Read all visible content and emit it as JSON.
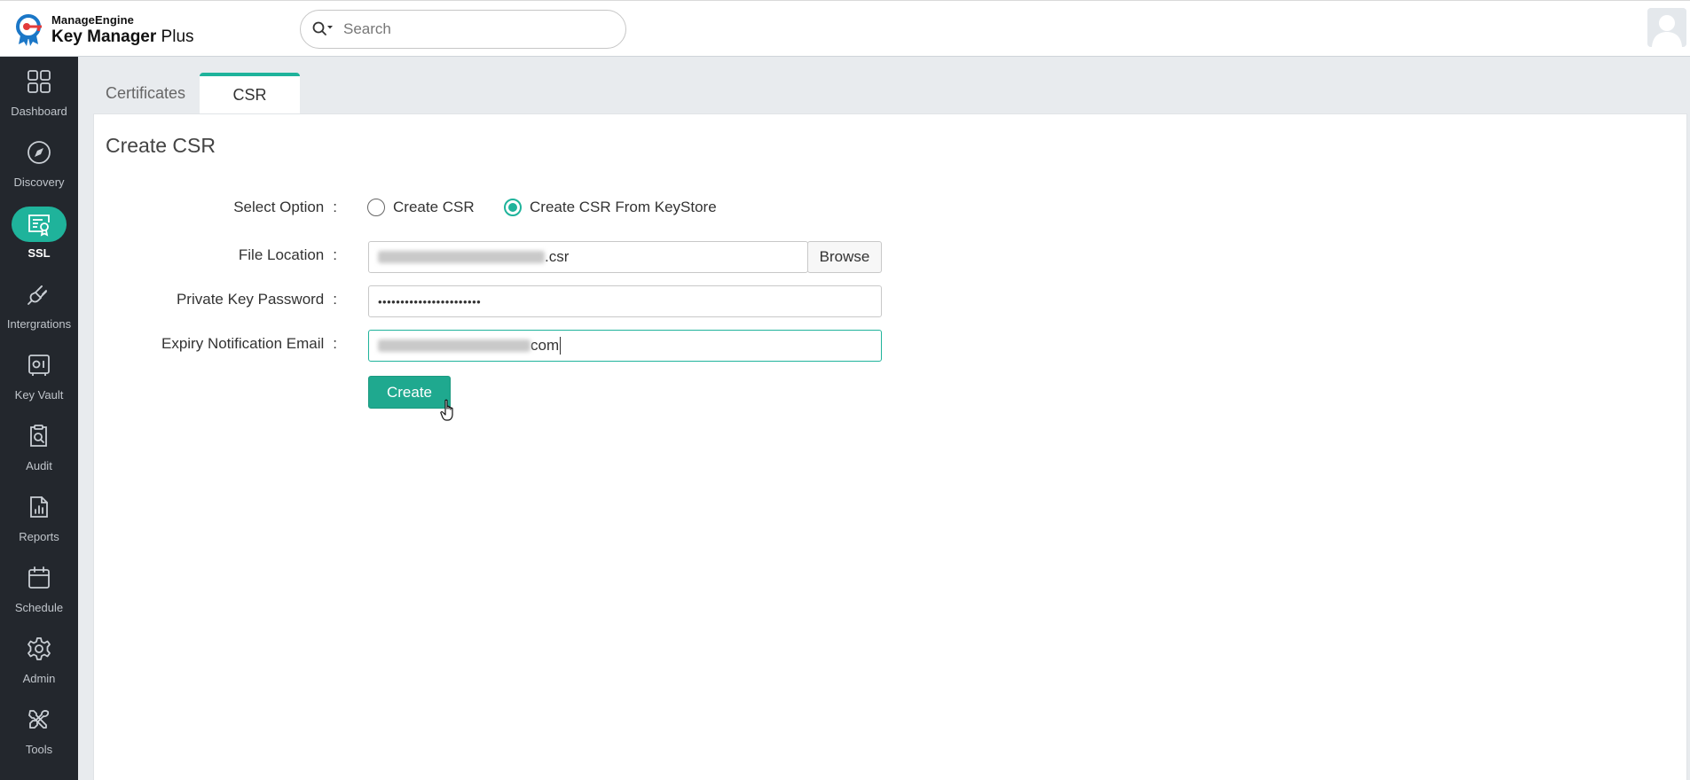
{
  "header": {
    "brand": "ManageEngine",
    "product_bold": "Key Manager",
    "product_rest": " Plus",
    "search_placeholder": "Search"
  },
  "sidebar": {
    "items": [
      {
        "label": "Dashboard",
        "icon": "dashboard-icon"
      },
      {
        "label": "Discovery",
        "icon": "compass-icon"
      },
      {
        "label": "SSL",
        "icon": "certificate-icon",
        "active": true
      },
      {
        "label": "Intergrations",
        "icon": "plug-icon"
      },
      {
        "label": "Key Vault",
        "icon": "vault-icon"
      },
      {
        "label": "Audit",
        "icon": "audit-icon"
      },
      {
        "label": "Reports",
        "icon": "report-icon"
      },
      {
        "label": "Schedule",
        "icon": "calendar-icon"
      },
      {
        "label": "Admin",
        "icon": "gear-icon"
      },
      {
        "label": "Tools",
        "icon": "tools-icon"
      }
    ]
  },
  "tabs": [
    {
      "label": "Certificates",
      "active": false
    },
    {
      "label": "CSR",
      "active": true
    }
  ],
  "form": {
    "title": "Create CSR",
    "select_option_label": "Select Option",
    "option_create_csr": "Create CSR",
    "option_from_keystore": "Create CSR From KeyStore",
    "selected_option": "Create CSR From KeyStore",
    "file_location_label": "File Location",
    "file_location_value_suffix": ".csr",
    "browse_label": "Browse",
    "private_key_password_label": "Private Key Password",
    "private_key_password_value": "•••••••••••••••••••••••",
    "expiry_email_label": "Expiry Notification Email",
    "expiry_email_value_suffix": "com",
    "create_label": "Create",
    "colon": ":"
  },
  "colors": {
    "accent": "#1fb39b",
    "sidebar_bg": "#23272d",
    "button": "#1fa98f"
  }
}
